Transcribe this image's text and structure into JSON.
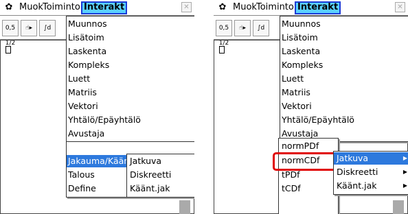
{
  "menubar": {
    "gear_icon": "gear-icon",
    "muok": "Muok",
    "toiminto": "Toiminto",
    "interakt": "Interakt",
    "close": "✕"
  },
  "toolbar": {
    "frac_btn": "0,5 1/2",
    "touch_btn": "☝▸",
    "int_btn": "∫d"
  },
  "main_menu": [
    {
      "label": "Muunnos",
      "arrow": "▶"
    },
    {
      "label": "Lisätoim",
      "arrow": "▶"
    },
    {
      "label": "Laskenta",
      "arrow": "▶"
    },
    {
      "label": "Kompleks",
      "arrow": "▶"
    },
    {
      "label": "Luett",
      "arrow": "▶"
    },
    {
      "label": "Matriis",
      "arrow": "▶"
    },
    {
      "label": "Vektori",
      "arrow": "▶"
    },
    {
      "label": "Yhtälö/Epäyhtälö",
      "arrow": "▶"
    },
    {
      "label": "Avustaja",
      "arrow": "▶"
    },
    {
      "label": "Jakauma/Käänt",
      "arrow": "▶"
    },
    {
      "label": "Talous",
      "arrow": "▶"
    },
    {
      "label": "Define",
      "arrow": ""
    }
  ],
  "submenu": [
    {
      "label": "Jatkuva",
      "arrow": "▶"
    },
    {
      "label": "Diskreetti",
      "arrow": "▶"
    },
    {
      "label": "Käänt.jak",
      "arrow": "▶"
    }
  ],
  "subsubmenu": [
    {
      "label": "normPDf"
    },
    {
      "label": "normCDf"
    },
    {
      "label": "tPDf"
    },
    {
      "label": "tCDf"
    }
  ],
  "colors": {
    "highlight": "#2d79dd",
    "interakt_bg": "#5ad0ff",
    "red_box": "#e00000"
  }
}
